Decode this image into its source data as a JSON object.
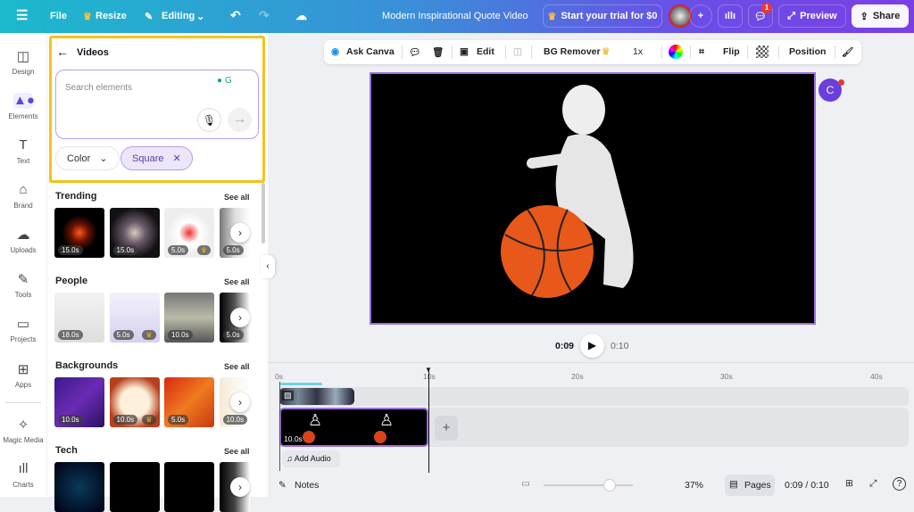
{
  "topbar": {
    "menu_icon": "hamburger-icon",
    "file": "File",
    "resize": "Resize",
    "editing": "Editing",
    "title": "Modern Inspirational Quote Video",
    "trial": "Start your trial for $0",
    "notification_count": "1",
    "preview": "Preview",
    "share": "Share"
  },
  "rail": [
    {
      "label": "Design",
      "icon": "design-icon"
    },
    {
      "label": "Elements",
      "icon": "elements-icon"
    },
    {
      "label": "Text",
      "icon": "text-icon"
    },
    {
      "label": "Brand",
      "icon": "brand-icon"
    },
    {
      "label": "Uploads",
      "icon": "uploads-icon"
    },
    {
      "label": "Tools",
      "icon": "tools-icon"
    },
    {
      "label": "Projects",
      "icon": "projects-icon"
    },
    {
      "label": "Apps",
      "icon": "apps-icon"
    },
    {
      "label": "Magic Media",
      "icon": "magic-media-icon"
    },
    {
      "label": "Charts",
      "icon": "charts-icon"
    }
  ],
  "panel": {
    "title": "Videos",
    "search_placeholder": "Search elements",
    "filter_color": "Color",
    "filter_square": "Square",
    "see_all": "See all",
    "sections": [
      {
        "title": "Trending",
        "items": [
          {
            "dur": "15.0s",
            "premium": false
          },
          {
            "dur": "15.0s",
            "premium": false
          },
          {
            "dur": "5.0s",
            "premium": true
          },
          {
            "dur": "5.0s",
            "premium": false
          }
        ]
      },
      {
        "title": "People",
        "items": [
          {
            "dur": "18.0s",
            "premium": false
          },
          {
            "dur": "5.0s",
            "premium": true
          },
          {
            "dur": "10.0s",
            "premium": false
          },
          {
            "dur": "5.0s",
            "premium": false
          }
        ]
      },
      {
        "title": "Backgrounds",
        "items": [
          {
            "dur": "10.0s",
            "premium": false
          },
          {
            "dur": "10.0s",
            "premium": true
          },
          {
            "dur": "5.0s",
            "premium": false
          },
          {
            "dur": "10.0s",
            "premium": false
          }
        ]
      },
      {
        "title": "Tech",
        "items": [
          {
            "dur": "",
            "premium": false
          },
          {
            "dur": "",
            "premium": false
          },
          {
            "dur": "",
            "premium": false
          },
          {
            "dur": "",
            "premium": false
          }
        ]
      }
    ]
  },
  "toolbar": {
    "ask_canva": "Ask Canva",
    "edit": "Edit",
    "bg_remover": "BG Remover",
    "speed": "1x",
    "flip": "Flip",
    "position": "Position"
  },
  "player": {
    "current": "0:09",
    "total": "0:10"
  },
  "timeline": {
    "ticks": [
      "0s",
      "10s",
      "20s",
      "30s",
      "40s"
    ],
    "clip_duration": "10.0s",
    "add_audio": "Add Audio",
    "progress_seconds": 9
  },
  "bottom": {
    "notes": "Notes",
    "zoom": "37%",
    "zoom_fraction": 0.3,
    "pages": "Pages",
    "time": "0:09 / 0:10"
  }
}
